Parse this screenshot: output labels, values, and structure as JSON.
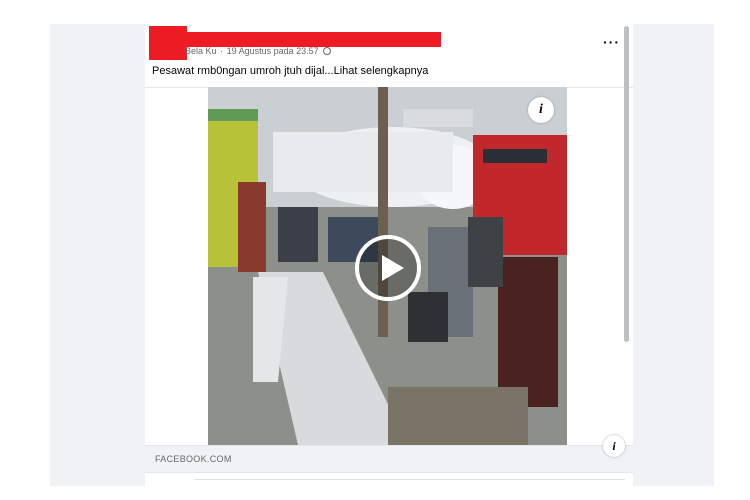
{
  "post": {
    "author_visible": "Bela Ku",
    "separator": "·",
    "timestamp": "19 Agustus pada 23.57",
    "visibility_icon": "globe-icon",
    "caption": "Pesawat rmb0ngan umroh jtuh dijal...Lihat selengkapnya",
    "menu_icon": "more-options-icon"
  },
  "media": {
    "type": "video",
    "play_icon": "play-icon",
    "info_icon_label": "i"
  },
  "link_preview": {
    "domain": "FACEBOOK.COM",
    "info_icon_label": "i"
  },
  "colors": {
    "redaction": "#ed1c24",
    "feed_background": "#f0f2f5",
    "secondary_text": "#65676b"
  }
}
